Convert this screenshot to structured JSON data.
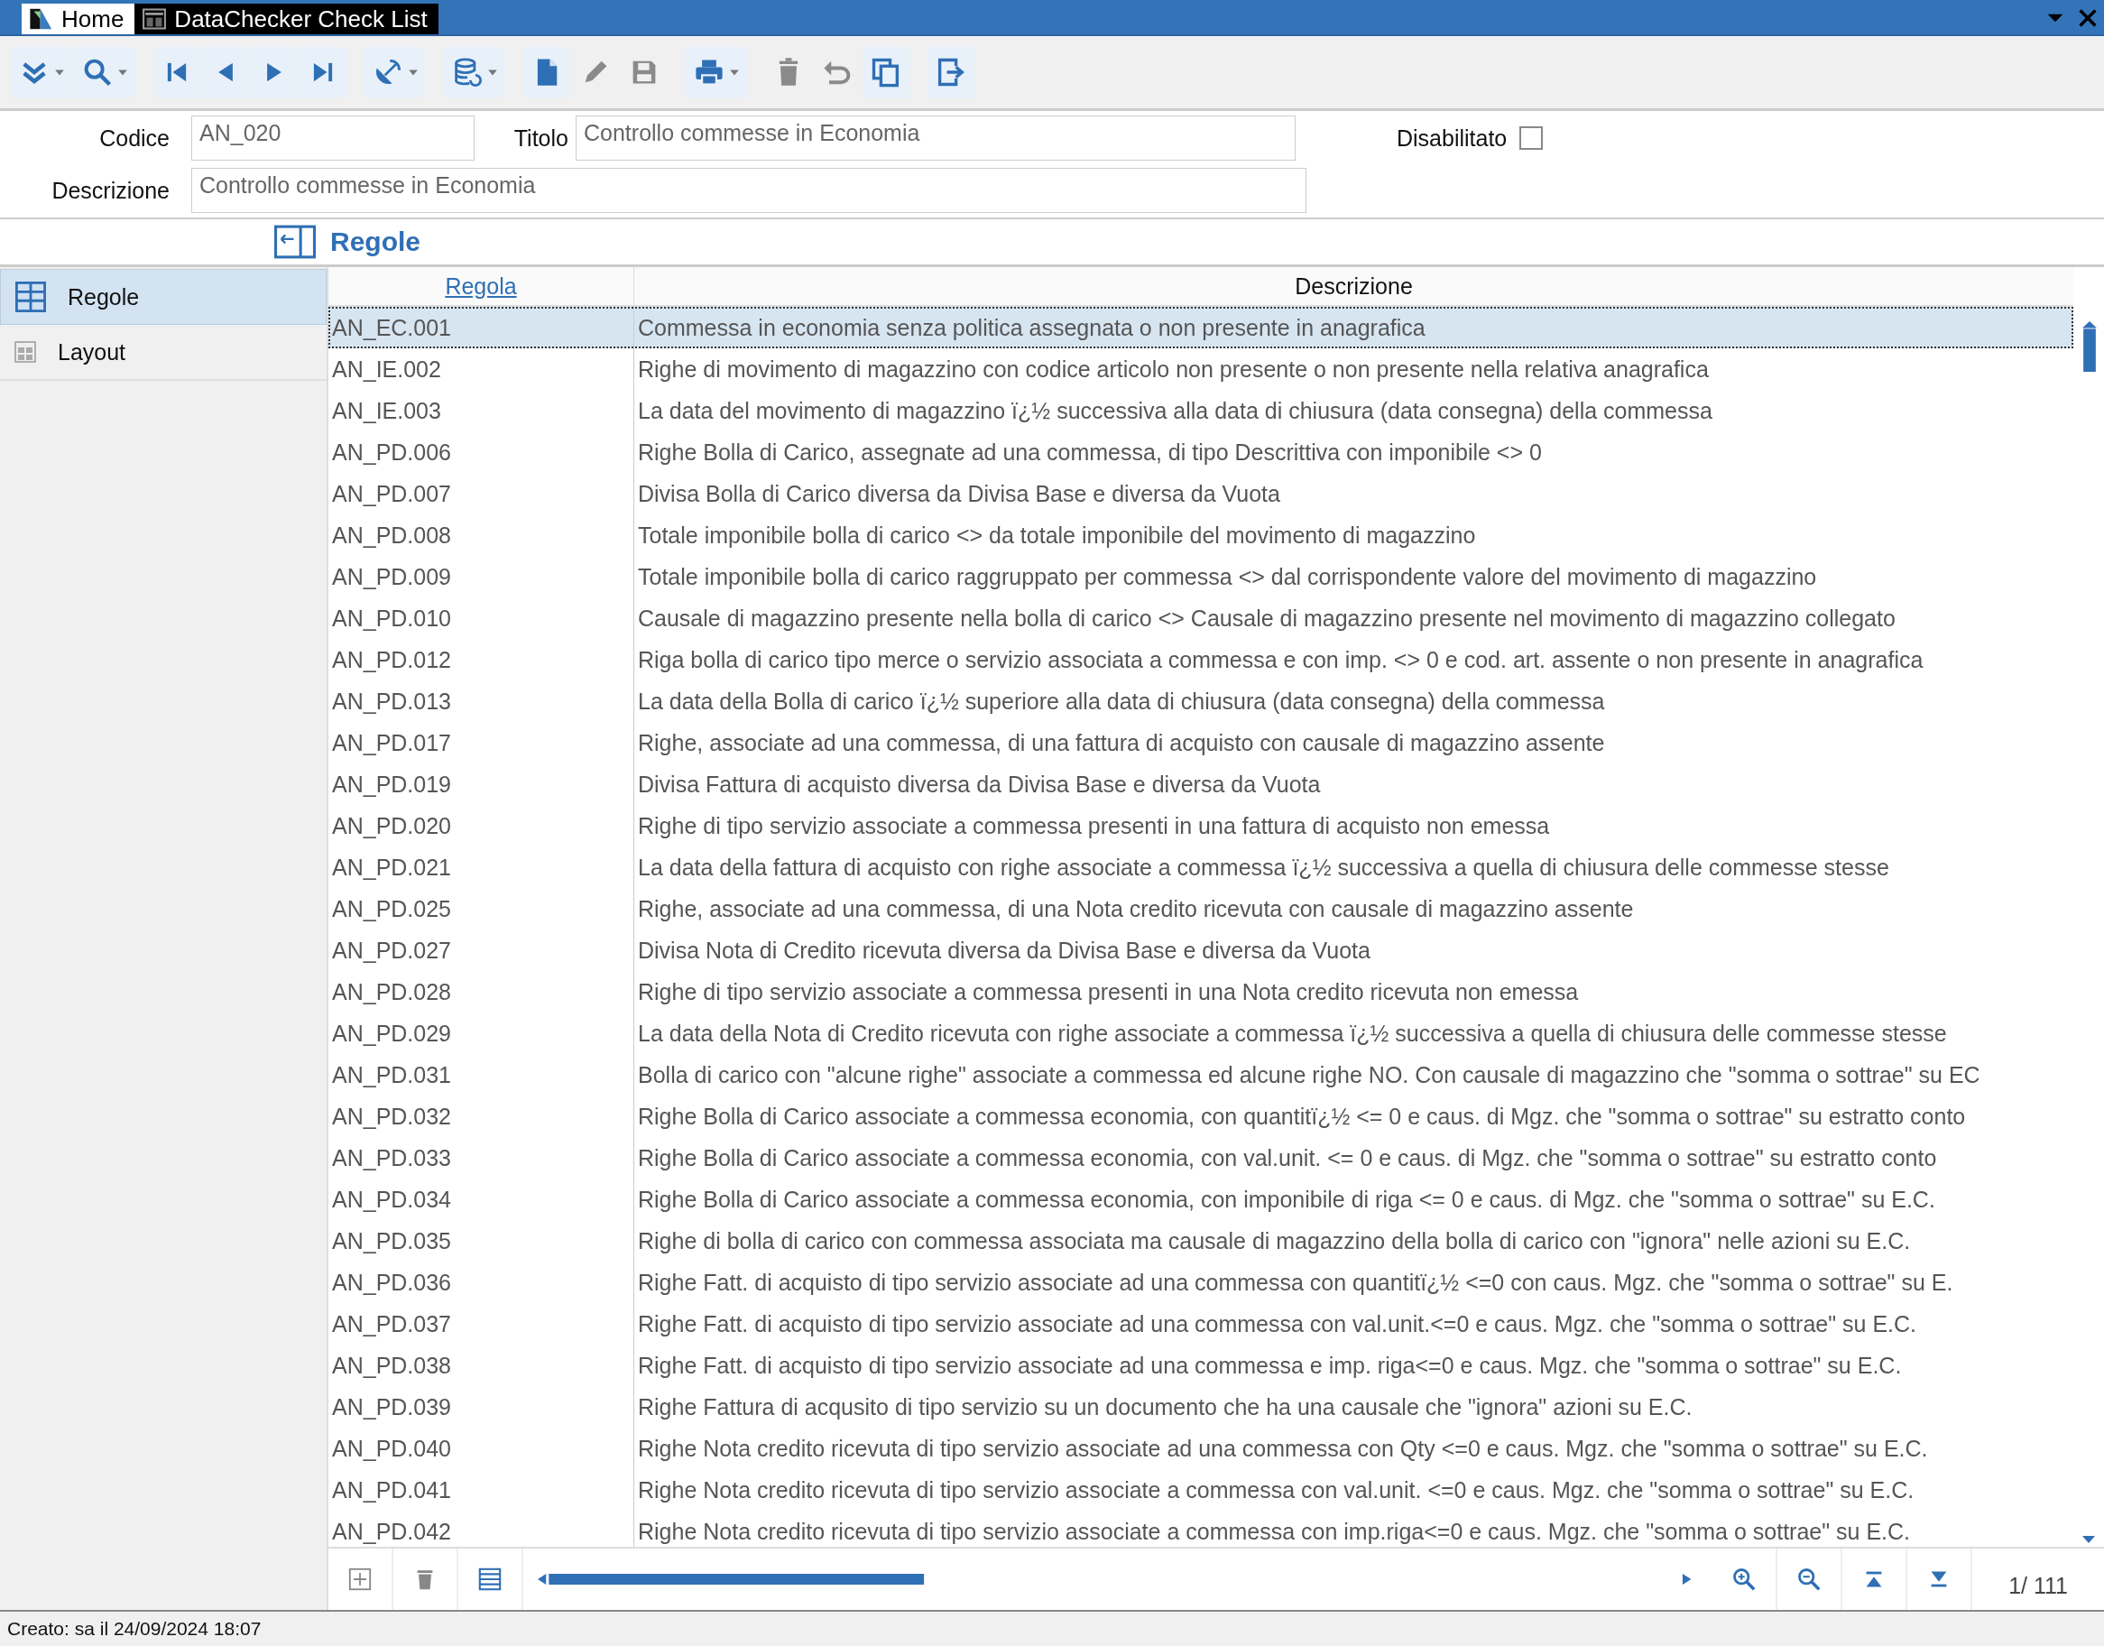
{
  "tabs": [
    {
      "label": "Home",
      "selected": false
    },
    {
      "label": "DataChecker Check List",
      "selected": true
    }
  ],
  "toolbar": [
    {
      "kind": "expand",
      "dropdown": true,
      "disabled": false
    },
    {
      "kind": "search",
      "dropdown": true,
      "disabled": false
    },
    {
      "kind": "first",
      "dropdown": false,
      "disabled": false
    },
    {
      "kind": "prev",
      "dropdown": false,
      "disabled": false
    },
    {
      "kind": "next",
      "dropdown": false,
      "disabled": false
    },
    {
      "kind": "last",
      "dropdown": false,
      "disabled": false
    },
    {
      "kind": "satellite",
      "dropdown": true,
      "disabled": false
    },
    {
      "kind": "database",
      "dropdown": true,
      "disabled": false
    },
    {
      "kind": "new",
      "dropdown": false,
      "disabled": false
    },
    {
      "kind": "edit",
      "dropdown": false,
      "disabled": true
    },
    {
      "kind": "save",
      "dropdown": false,
      "disabled": true
    },
    {
      "kind": "print",
      "dropdown": true,
      "disabled": false
    },
    {
      "kind": "delete",
      "dropdown": false,
      "disabled": true
    },
    {
      "kind": "undo",
      "dropdown": false,
      "disabled": true
    },
    {
      "kind": "copy",
      "dropdown": false,
      "disabled": false
    },
    {
      "kind": "exit",
      "dropdown": false,
      "disabled": false
    }
  ],
  "form": {
    "codice_label": "Codice",
    "codice": "AN_020",
    "titolo_label": "Titolo",
    "titolo": "Controllo commesse in Economia",
    "disabilitato_label": "Disabilitato",
    "disabilitato": false,
    "descrizione_label": "Descrizione",
    "descrizione": "Controllo commesse in Economia"
  },
  "section_title": "Regole",
  "sidebar": {
    "items": [
      {
        "label": "Regole",
        "selected": true,
        "kind": "grid"
      },
      {
        "label": "Layout",
        "selected": false,
        "kind": "layout"
      }
    ]
  },
  "table": {
    "columns": [
      "Regola",
      "Descrizione"
    ],
    "rows": [
      {
        "code": "AN_EC.001",
        "description": "Commessa in economia senza politica assegnata o non presente in anagrafica",
        "selected": true
      },
      {
        "code": "AN_IE.002",
        "description": "Righe di movimento di magazzino con codice articolo non presente o non presente nella relativa anagrafica",
        "selected": false
      },
      {
        "code": "AN_IE.003",
        "description": "La data del movimento di magazzino ï¿½ successiva alla data di chiusura (data consegna) della commessa",
        "selected": false
      },
      {
        "code": "AN_PD.006",
        "description": "Righe Bolla di Carico, assegnate ad una commessa, di tipo Descrittiva con imponibile <> 0",
        "selected": false
      },
      {
        "code": "AN_PD.007",
        "description": "Divisa Bolla di Carico diversa da Divisa Base e diversa da Vuota",
        "selected": false
      },
      {
        "code": "AN_PD.008",
        "description": "Totale imponibile bolla di carico <> da totale imponibile del movimento di magazzino",
        "selected": false
      },
      {
        "code": "AN_PD.009",
        "description": "Totale imponibile bolla di carico raggruppato per commessa <> dal corrispondente valore del movimento di magazzino",
        "selected": false
      },
      {
        "code": "AN_PD.010",
        "description": "Causale di magazzino presente nella bolla di carico <> Causale di magazzino presente nel movimento di magazzino collegato",
        "selected": false
      },
      {
        "code": "AN_PD.012",
        "description": "Riga bolla di carico tipo merce o servizio associata a commessa e con imp. <> 0 e cod. art. assente o non presente in anagrafica",
        "selected": false
      },
      {
        "code": "AN_PD.013",
        "description": "La data della Bolla di carico ï¿½ superiore alla data di chiusura (data consegna) della commessa",
        "selected": false
      },
      {
        "code": "AN_PD.017",
        "description": "Righe, associate ad una commessa, di una fattura di acquisto con causale di magazzino assente",
        "selected": false
      },
      {
        "code": "AN_PD.019",
        "description": "Divisa Fattura di acquisto diversa da Divisa Base e diversa da Vuota",
        "selected": false
      },
      {
        "code": "AN_PD.020",
        "description": "Righe di tipo servizio associate a commessa presenti in una fattura di acquisto non emessa",
        "selected": false
      },
      {
        "code": "AN_PD.021",
        "description": "La data della fattura di acquisto con righe associate a commessa ï¿½ successiva a quella di chiusura delle commesse stesse",
        "selected": false
      },
      {
        "code": "AN_PD.025",
        "description": "Righe, associate ad una commessa, di una Nota credito ricevuta con causale di magazzino assente",
        "selected": false
      },
      {
        "code": "AN_PD.027",
        "description": "Divisa Nota di Credito ricevuta diversa da Divisa Base e diversa da Vuota",
        "selected": false
      },
      {
        "code": "AN_PD.028",
        "description": "Righe di tipo servizio associate a commessa presenti in una Nota credito ricevuta non emessa",
        "selected": false
      },
      {
        "code": "AN_PD.029",
        "description": "La data della Nota di Credito ricevuta con righe associate a commessa ï¿½ successiva a quella di chiusura delle commesse stesse",
        "selected": false
      },
      {
        "code": "AN_PD.031",
        "description": "Bolla di carico con \"alcune righe\" associate a commessa ed alcune righe NO. Con causale di magazzino che \"somma o sottrae\" su EC",
        "selected": false
      },
      {
        "code": "AN_PD.032",
        "description": "Righe Bolla di Carico associate a commessa economia, con quantitï¿½ <= 0 e caus. di Mgz. che \"somma o sottrae\" su estratto conto",
        "selected": false
      },
      {
        "code": "AN_PD.033",
        "description": "Righe Bolla di Carico associate a commessa economia, con val.unit. <= 0 e caus. di Mgz. che \"somma o sottrae\" su estratto conto",
        "selected": false
      },
      {
        "code": "AN_PD.034",
        "description": "Righe Bolla di Carico associate a commessa economia, con imponibile di riga <= 0 e caus. di Mgz. che \"somma o sottrae\" su E.C.",
        "selected": false
      },
      {
        "code": "AN_PD.035",
        "description": "Righe di bolla di carico con commessa associata ma causale di magazzino della bolla di carico con \"ignora\" nelle azioni su E.C.",
        "selected": false
      },
      {
        "code": "AN_PD.036",
        "description": "Righe Fatt. di acquisto di tipo servizio associate ad una commessa con quantitï¿½ <=0 con caus. Mgz. che \"somma o sottrae\" su E.",
        "selected": false
      },
      {
        "code": "AN_PD.037",
        "description": "Righe Fatt. di acquisto di tipo servizio associate ad una commessa con val.unit.<=0 e caus. Mgz. che \"somma o sottrae\" su E.C.",
        "selected": false
      },
      {
        "code": "AN_PD.038",
        "description": "Righe Fatt. di acquisto di tipo servizio associate ad una commessa e imp. riga<=0 e caus. Mgz. che \"somma o sottrae\" su E.C.",
        "selected": false
      },
      {
        "code": "AN_PD.039",
        "description": "Righe Fattura di acqusito di tipo servizio su un documento che ha una causale che \"ignora\" azioni su E.C.",
        "selected": false
      },
      {
        "code": "AN_PD.040",
        "description": "Righe Nota credito ricevuta di tipo servizio associate ad una commessa con Qty <=0 e caus. Mgz. che \"somma o sottrae\" su E.C.",
        "selected": false
      },
      {
        "code": "AN_PD.041",
        "description": "Righe Nota credito ricevuta di tipo servizio associate a commessa con val.unit. <=0 e caus. Mgz. che \"somma o sottrae\" su E.C.",
        "selected": false
      },
      {
        "code": "AN_PD.042",
        "description": "Righe Nota credito ricevuta di tipo servizio associate a commessa con imp.riga<=0 e caus. Mgz. che \"somma o sottrae\" su E.C.",
        "selected": false
      }
    ]
  },
  "pager": {
    "position": "1/ 111"
  },
  "status_bar": "Creato: sa il 24/09/2024 18:07"
}
